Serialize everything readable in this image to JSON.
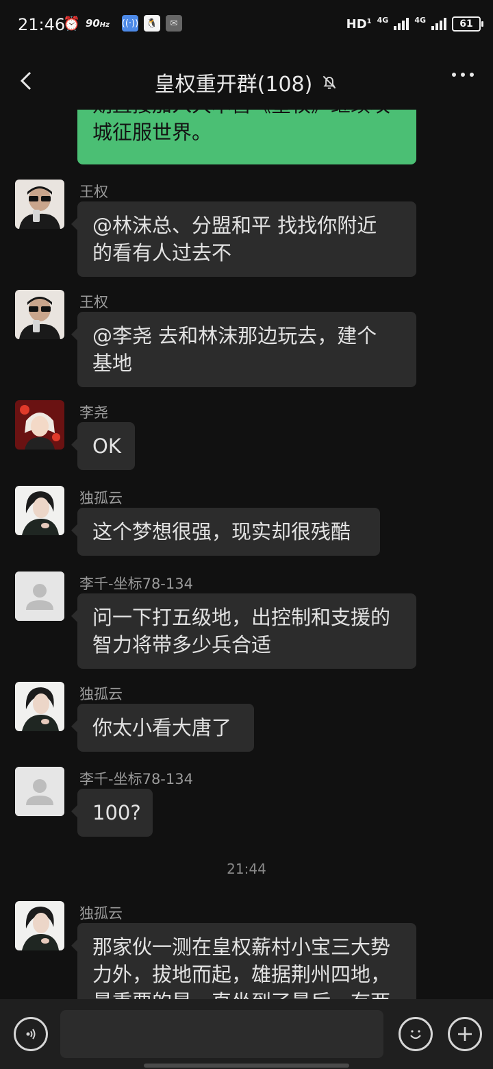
{
  "status_bar": {
    "time": "21:46",
    "refresh": "90",
    "refresh_unit": "Hz",
    "hd": "HD",
    "net1": "4G",
    "net2": "4G",
    "battery": "61"
  },
  "header": {
    "title": "皇权重开群(108)",
    "icons": {
      "back": "back-chevron-icon",
      "mute": "bell-off-icon",
      "more": "more-dots-icon"
    }
  },
  "messages": [
    {
      "type": "self",
      "lines": "期直接加入大本营《皇权》继续攻\n城征服世界。"
    },
    {
      "type": "other",
      "sender": "王权",
      "avatar": "sunglasses-man",
      "text": "@林沫总、分盟和平  找找你附近\n的看有人过去不"
    },
    {
      "type": "other",
      "sender": "王权",
      "avatar": "sunglasses-man",
      "text": "@李尧  去和林沫那边玩去，建个\n基地"
    },
    {
      "type": "other",
      "sender": "李尧",
      "avatar": "anime-character",
      "text": "OK"
    },
    {
      "type": "other",
      "sender": "独孤云",
      "avatar": "woman-portrait",
      "text": "这个梦想很强，现实却很残酷"
    },
    {
      "type": "other",
      "sender": "李千-坐标78-134",
      "avatar": "default-user",
      "text": "问一下打五级地，出控制和支援的\n智力将带多少兵合适"
    },
    {
      "type": "other",
      "sender": "独孤云",
      "avatar": "woman-portrait",
      "text": "你太小看大唐了"
    },
    {
      "type": "other",
      "sender": "李千-坐标78-134",
      "avatar": "default-user",
      "text": "100?"
    },
    {
      "type": "time",
      "text": "21:44"
    },
    {
      "type": "other",
      "sender": "独孤云",
      "avatar": "woman-portrait",
      "text": "那家伙一测在皇权薪村小宝三大势\n力外，拔地而起，雄据荆州四地，\n最重要的是，直坐到了最后，有两"
    }
  ],
  "input_bar": {
    "placeholder": "",
    "icons": {
      "voice": "voice-icon",
      "emoji": "emoji-icon",
      "plus": "plus-icon"
    }
  },
  "colors": {
    "background": "#111111",
    "bubble_other": "#2c2c2c",
    "bubble_self": "#4bbf74"
  }
}
